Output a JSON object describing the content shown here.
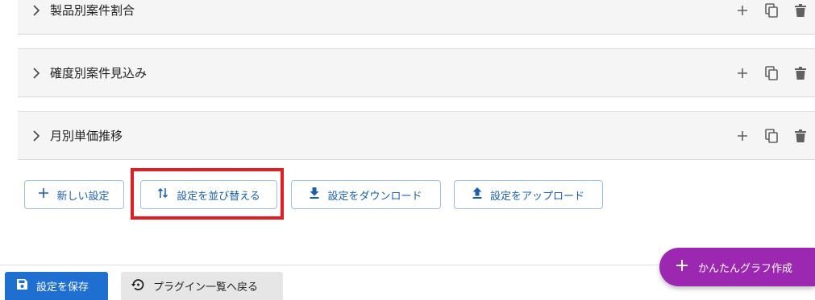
{
  "settings_rows": [
    {
      "title": "製品別案件割合"
    },
    {
      "title": "確度別案件見込み"
    },
    {
      "title": "月別単価推移"
    }
  ],
  "toolbar": {
    "new_label": "新しい設定",
    "sort_label": "設定を並び替える",
    "download_label": "設定をダウンロード",
    "upload_label": "設定をアップロード"
  },
  "footer": {
    "save_label": "設定を保存",
    "back_label": "プラグイン一覧へ戻る"
  },
  "fab": {
    "label": "かんたんグラフ作成"
  },
  "colors": {
    "accent_blue": "#1f6fd1",
    "outline_text": "#1a5fa8",
    "fab_purple": "#9c27b0",
    "highlight_red": "#e21d24",
    "icon_gray": "#616161"
  }
}
